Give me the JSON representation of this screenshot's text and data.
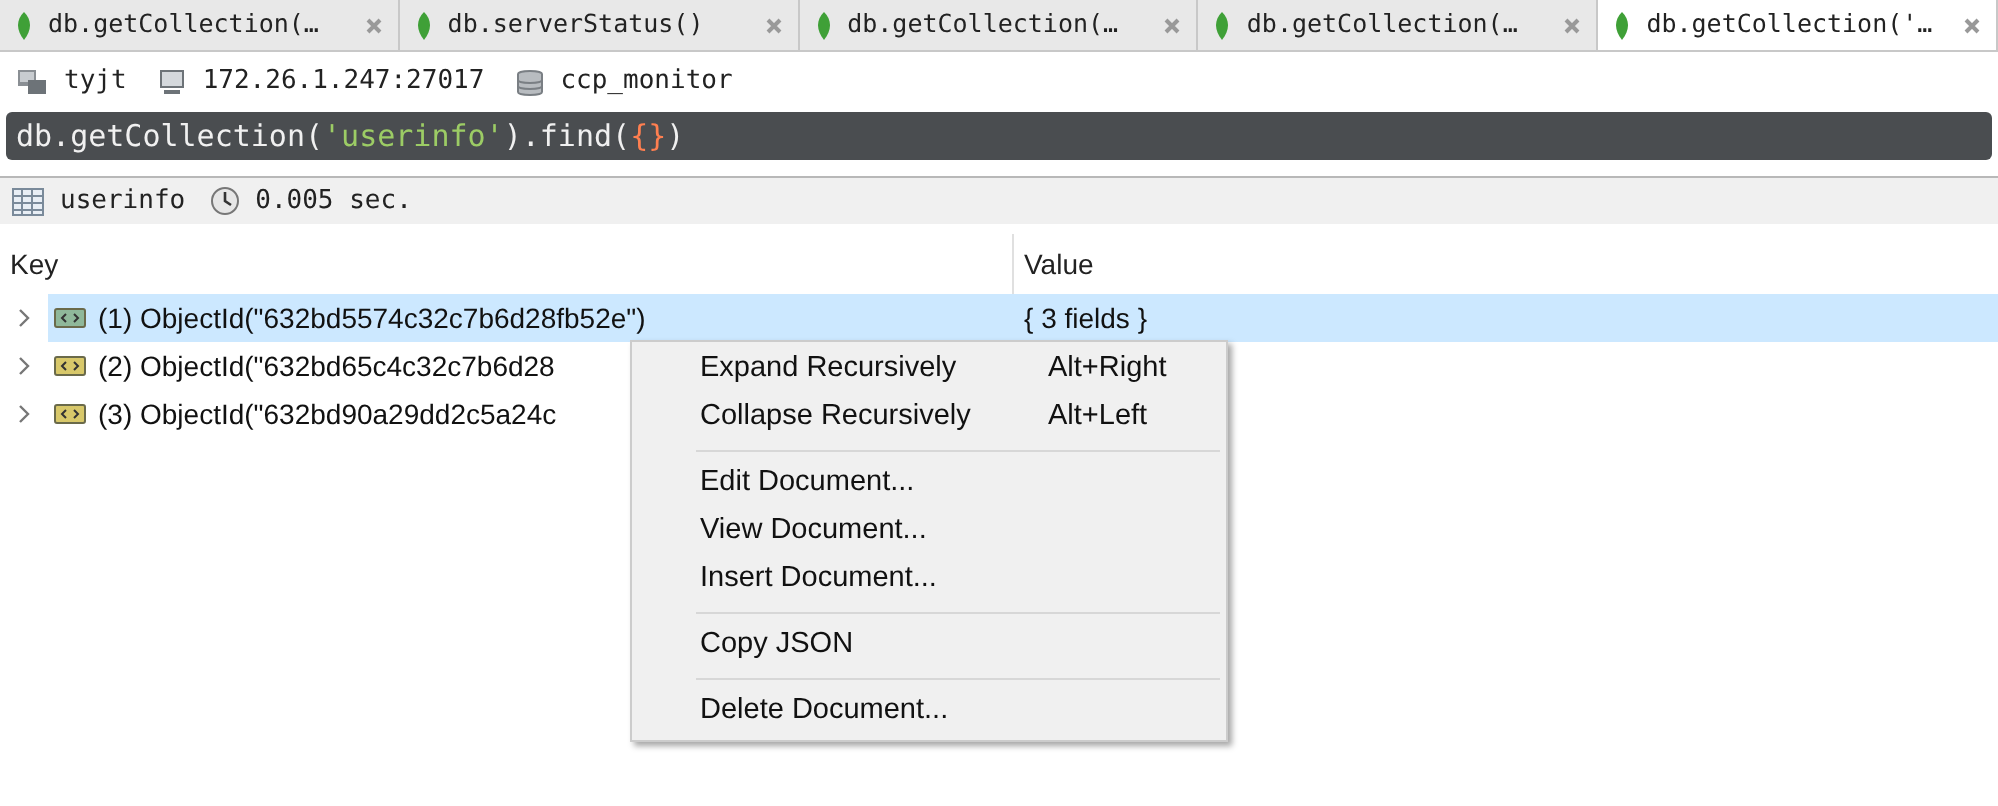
{
  "tabs": [
    {
      "label": "db.getCollection(…",
      "selected": false
    },
    {
      "label": "db.serverStatus()",
      "selected": false
    },
    {
      "label": "db.getCollection(…",
      "selected": false
    },
    {
      "label": "db.getCollection(…",
      "selected": false
    },
    {
      "label": "db.getCollection('…",
      "selected": true
    }
  ],
  "connection": [
    {
      "kind": "server",
      "text": "tyjt"
    },
    {
      "kind": "computer",
      "text": "172.26.1.247:27017"
    },
    {
      "kind": "database",
      "text": "ccp_monitor"
    }
  ],
  "query": [
    {
      "kind": "plain",
      "text": "db.getCollection("
    },
    {
      "kind": "string",
      "text": "'userinfo'"
    },
    {
      "kind": "plain",
      "text": ").find("
    },
    {
      "kind": "brace",
      "text": "{}"
    },
    {
      "kind": "plain",
      "text": ")"
    }
  ],
  "status": [
    {
      "kind": "table",
      "text": "userinfo"
    },
    {
      "kind": "clock",
      "text": "0.005 sec."
    }
  ],
  "table": {
    "columns": [
      "Key",
      "Value"
    ],
    "rows": [
      {
        "key": "(1) ObjectId(\"632bd5574c32c7b6d28fb52e\")",
        "value": "{ 3 fields }",
        "selected": true
      },
      {
        "key": "(2) ObjectId(\"632bd65c4c32c7b6d28",
        "selected": false
      },
      {
        "key": "(3) ObjectId(\"632bd90a29dd2c5a24c",
        "selected": false
      }
    ]
  },
  "context_menu": [
    {
      "kind": "item",
      "label": "Expand Recursively",
      "shortcut": "Alt+Right"
    },
    {
      "kind": "item",
      "label": "Collapse Recursively",
      "shortcut": "Alt+Left"
    },
    {
      "kind": "separator"
    },
    {
      "kind": "item",
      "label": "Edit Document..."
    },
    {
      "kind": "item",
      "label": "View Document..."
    },
    {
      "kind": "item",
      "label": "Insert Document..."
    },
    {
      "kind": "separator"
    },
    {
      "kind": "item",
      "label": "Copy JSON"
    },
    {
      "kind": "separator"
    },
    {
      "kind": "item",
      "label": "Delete Document..."
    }
  ]
}
